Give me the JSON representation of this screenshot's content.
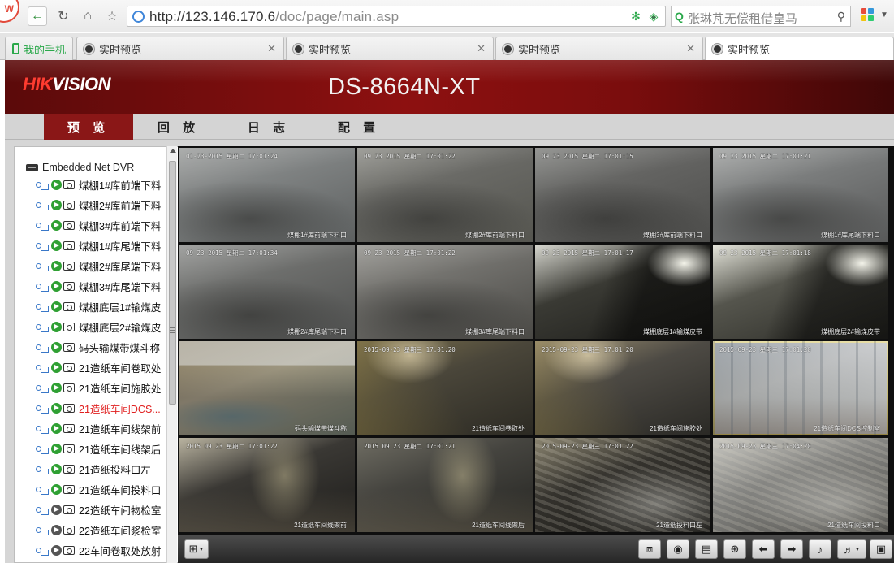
{
  "browser": {
    "logo_partial": "W",
    "url_host": "http://123.146.170.6",
    "url_path": "/doc/page/main.asp",
    "search_text": "张琳芃无偿租借皇马",
    "tabs": [
      {
        "label": "我的手机",
        "kind": "phone"
      },
      {
        "label": "实时预览",
        "kind": "page"
      },
      {
        "label": "实时预览",
        "kind": "page"
      },
      {
        "label": "实时预览",
        "kind": "page"
      },
      {
        "label": "实时预览",
        "kind": "page",
        "active": true
      }
    ]
  },
  "app": {
    "brand": "HIKVISION",
    "model": "DS-8664N-XT",
    "menu": [
      "预 览",
      "回 放",
      "日 志",
      "配 置"
    ],
    "active_menu": "预 览",
    "accent_color": "#8a1717"
  },
  "device_tree": {
    "root": "Embedded Net DVR",
    "channels": [
      {
        "label": "煤棚1#库前端下料",
        "online": true
      },
      {
        "label": "煤棚2#库前端下料",
        "online": true
      },
      {
        "label": "煤棚3#库前端下料",
        "online": true
      },
      {
        "label": "煤棚1#库尾端下料",
        "online": true
      },
      {
        "label": "煤棚2#库尾端下料",
        "online": true
      },
      {
        "label": "煤棚3#库尾端下料",
        "online": true
      },
      {
        "label": "煤棚底层1#输煤皮",
        "online": true
      },
      {
        "label": "煤棚底层2#输煤皮",
        "online": true
      },
      {
        "label": "码头输煤带煤斗称",
        "online": true
      },
      {
        "label": "21造纸车间卷取处",
        "online": true
      },
      {
        "label": "21造纸车间施胶处",
        "online": true
      },
      {
        "label": "21造纸车间DCS...",
        "online": true,
        "selected": true
      },
      {
        "label": "21造纸车间线架前",
        "online": true
      },
      {
        "label": "21造纸车间线架后",
        "online": true
      },
      {
        "label": "21造纸投料口左",
        "online": true
      },
      {
        "label": "21造纸车间投料口",
        "online": true
      },
      {
        "label": "22造纸车间物检室",
        "online": false
      },
      {
        "label": "22造纸车间浆检室",
        "online": false
      },
      {
        "label": "22车间卷取处放射",
        "online": false
      }
    ]
  },
  "video_tiles": [
    {
      "timestamp": "01-23-2015 星期二 17:01:24",
      "name": "煤棚1#库前端下料口"
    },
    {
      "timestamp": "09 23 2015 星期二 17:01:22",
      "name": "煤棚2#库前端下料口"
    },
    {
      "timestamp": "09 23 2015 星期二 17:01:15",
      "name": "煤棚3#库前端下料口"
    },
    {
      "timestamp": "09 23 2015 星期二 17:01:21",
      "name": "煤棚1#库尾端下料口"
    },
    {
      "timestamp": "09 23 2015 星期二 17:01:34",
      "name": "煤棚2#库尾端下料口"
    },
    {
      "timestamp": "09 23 2015 星期二 17:01:22",
      "name": "煤棚3#库尾端下料口"
    },
    {
      "timestamp": "09 23 2015 星期二 17:01:17",
      "name": "煤棚底层1#输煤皮带"
    },
    {
      "timestamp": "09 23 2015 星期二 17:01:18",
      "name": "煤棚底层2#输煤皮带"
    },
    {
      "timestamp": "",
      "name": "码头输煤带煤斗称"
    },
    {
      "timestamp": "2015-09-23 星期三 17:01:20",
      "name": "21造纸车间卷取处"
    },
    {
      "timestamp": "2015-09-23 星期三 17:01:20",
      "name": "21造纸车间施胶处"
    },
    {
      "timestamp": "2015-09-23 星期三 17:01:20",
      "name": "21造纸车间DCS控制室",
      "selected": true
    },
    {
      "timestamp": "2015 09 23 星期二 17:01:22",
      "name": "21造纸车间线架前"
    },
    {
      "timestamp": "2015 09 23 星期二 17:01:21",
      "name": "21造纸车间线架后"
    },
    {
      "timestamp": "2015-09-23 星期三 17:01:22",
      "name": "21造纸投料口左"
    },
    {
      "timestamp": "2015-09-23 星期三 17:04:20",
      "name": "21造纸车间投料口"
    }
  ],
  "toolbar": {
    "layout_icon": "grid-layout-icon",
    "buttons": [
      {
        "name": "stop-all-button",
        "icon": "window-stop-icon"
      },
      {
        "name": "capture-button",
        "icon": "camera-icon"
      },
      {
        "name": "record-button",
        "icon": "film-icon"
      },
      {
        "name": "zoom-button",
        "icon": "zoom-in-icon"
      },
      {
        "name": "prev-page-button",
        "icon": "arrow-left-icon"
      },
      {
        "name": "next-page-button",
        "icon": "arrow-right-icon"
      },
      {
        "name": "talk-button",
        "icon": "microphone-icon"
      },
      {
        "name": "volume-button",
        "icon": "speaker-muted-icon"
      },
      {
        "name": "fullscreen-button",
        "icon": "fullscreen-icon"
      }
    ]
  }
}
